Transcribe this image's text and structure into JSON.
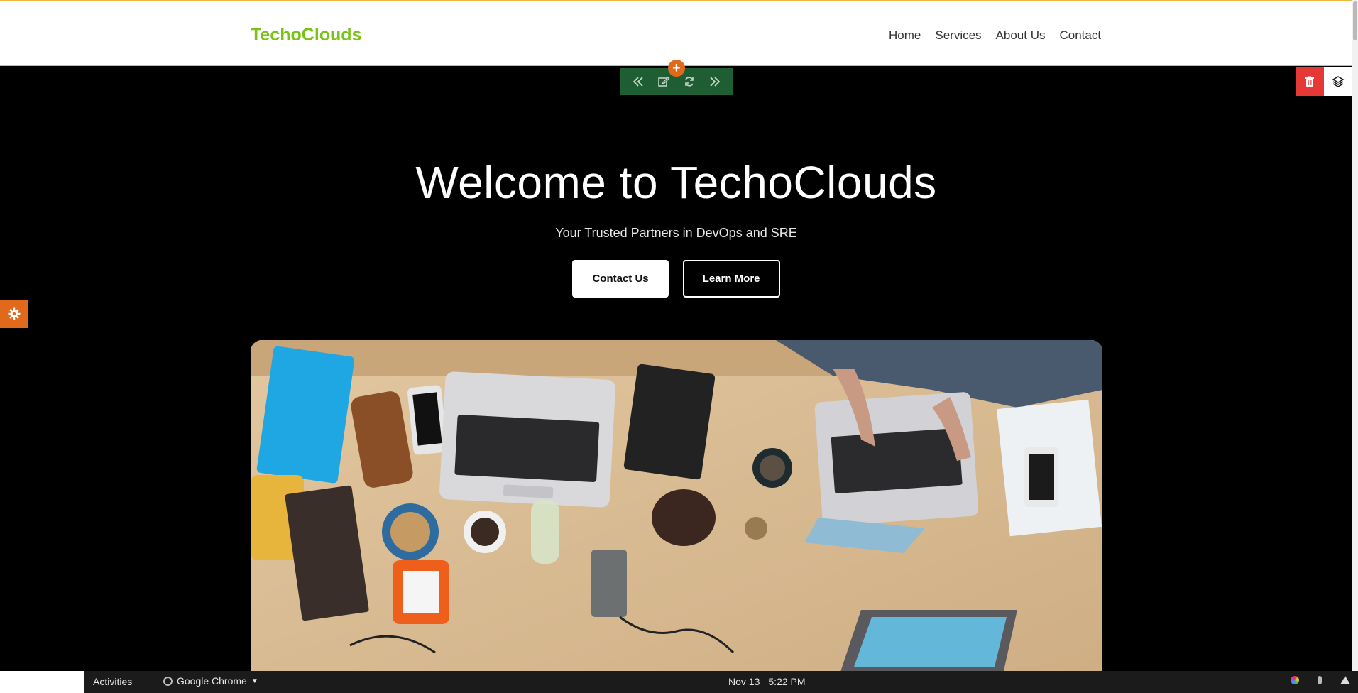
{
  "header": {
    "brand": "TechoClouds",
    "nav": [
      "Home",
      "Services",
      "About Us",
      "Contact"
    ]
  },
  "hero": {
    "title": "Welcome to TechoClouds",
    "subtitle": "Your Trusted Partners in DevOps and SRE",
    "primary_button": "Contact Us",
    "secondary_button": "Learn More"
  },
  "editor": {
    "add_symbol": "+",
    "toolbar_icons": [
      "double-chevron-left-icon",
      "edit-icon",
      "refresh-icon",
      "double-chevron-right-icon"
    ],
    "delete_icon": "trash-icon",
    "layers_icon": "layers-icon",
    "settings_icon": "gear-icon"
  },
  "taskbar": {
    "activities": "Activities",
    "app_name": "Google Chrome",
    "date": "Nov 13",
    "time": "5:22 PM"
  },
  "colors": {
    "brand": "#79c316",
    "header_border": "#f0b73f",
    "toolbar": "#1f5e32",
    "accent_orange": "#e0691c",
    "delete_red": "#e53935"
  }
}
